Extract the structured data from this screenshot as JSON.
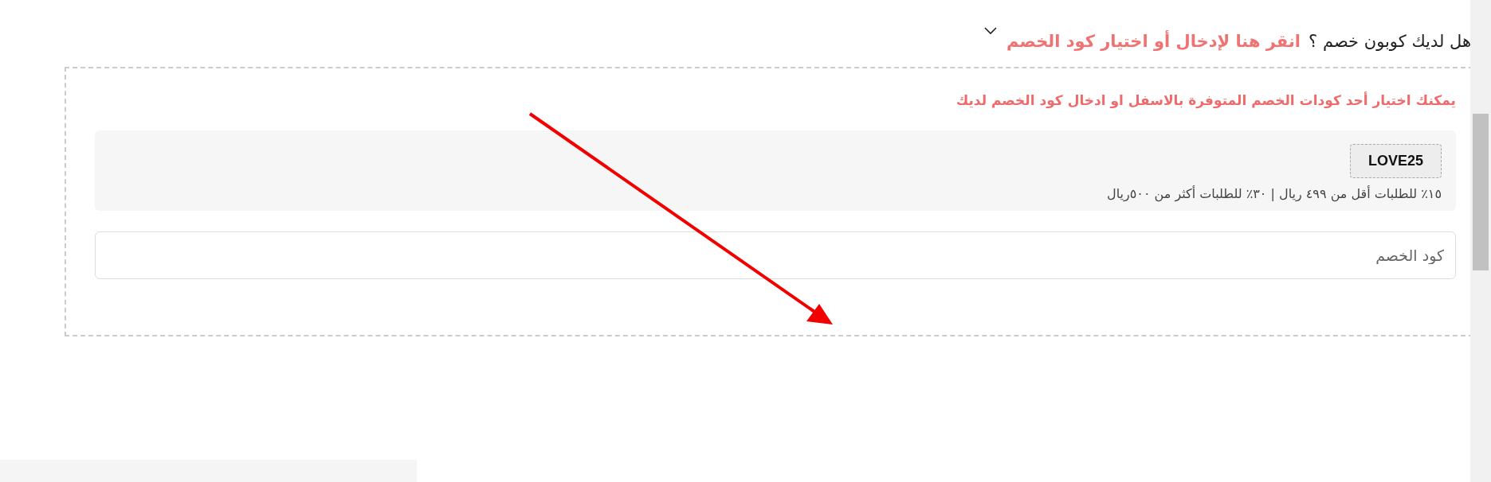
{
  "coupon_prompt": {
    "question": "هل لديك كوبون خصم ؟",
    "link": "انقر هنا لإدخال أو اختيار كود الخصم",
    "expanded": true
  },
  "coupon_panel": {
    "hint": "يمكنك اختيار أحد كودات الخصم المتوفرة بالاسفل او ادخال كود الخصم لديك",
    "coupons": [
      {
        "code": "LOVE25",
        "description": "١٥٪ للطلبات أقل من ٤٩٩ ريال | ٣٠٪ للطلبات أكثر من ٥٠٠ريال"
      }
    ],
    "code_field": {
      "placeholder": "كود الخصم"
    }
  }
}
